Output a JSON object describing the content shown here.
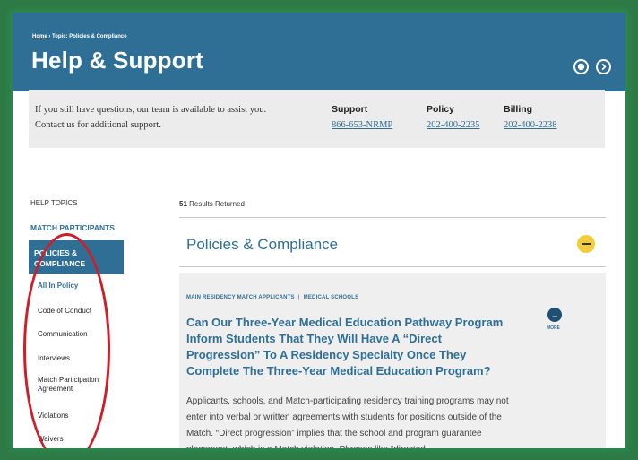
{
  "header": {
    "breadcrumb_home": "Home",
    "breadcrumb_rest": " › Topic: Policies & Compliance",
    "title": "Help & Support"
  },
  "contact": {
    "line1": "If you still have questions, our team is available to assist you.",
    "line2": "Contact us for additional support.",
    "support_label": "Support",
    "support_number": "866-653-NRMP",
    "policy_label": "Policy",
    "policy_number": "202-400-2235",
    "billing_label": "Billing",
    "billing_number": "202-400-2238"
  },
  "sidebar": {
    "heading": "HELP TOPICS",
    "match_participants": "MATCH PARTICIPANTS",
    "active_category": "POLICIES & COMPLIANCE",
    "items": [
      "All In Policy",
      "Code of Conduct",
      "Communication",
      "Interviews",
      "Match Participation Agreement",
      "Violations",
      "Waivers"
    ]
  },
  "main": {
    "results_count": "51",
    "results_text": " Results Returned",
    "section_title": "Policies & Compliance",
    "card": {
      "tag1": "MAIN RESIDENCY MATCH APPLICANTS",
      "tag_sep": "|",
      "tag2": "MEDICAL SCHOOLS",
      "title": "Can Our Three-Year Medical Education Pathway Program Inform Students That They Will Have A “Direct Progression” To A Residency Specialty Once They Complete The Three-Year Medical Education Program?",
      "body": "Applicants, schools, and Match-participating residency training programs may not enter into verbal or written agreements with students for positions outside of the Match. “Direct progression” implies that the school and program guarantee placement, which is a Match violation. Phrases like “directed",
      "more_label": "MORE",
      "more_icon": "arrow-right-icon"
    }
  },
  "colors": {
    "brand_blue": "#2f6f96",
    "accent_yellow": "#f2cc3c",
    "annotation_red": "#cc1f2a"
  }
}
